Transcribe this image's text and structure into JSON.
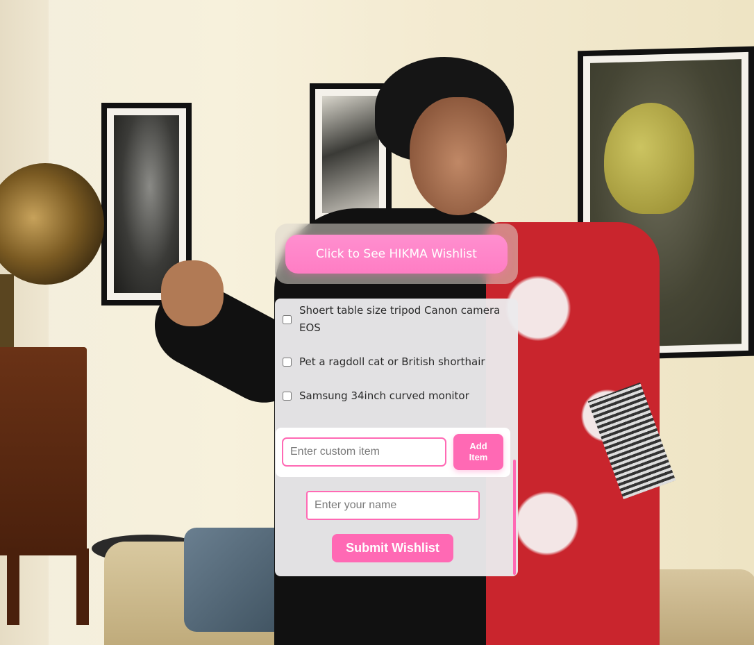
{
  "wishlist": {
    "toggle_label": "Click to See HIKMA Wishlist",
    "items": [
      {
        "label": "Shoert table size tripod Canon camera EOS",
        "checked": false
      },
      {
        "label": "Pet a ragdoll cat or British shorthair",
        "checked": false
      },
      {
        "label": "Samsung 34inch curved monitor",
        "checked": false
      }
    ],
    "custom_item": {
      "placeholder": "Enter custom item",
      "value": "",
      "add_label": "Add Item"
    },
    "name_field": {
      "placeholder": "Enter your name",
      "value": ""
    },
    "submit_label": "Submit Wishlist"
  },
  "colors": {
    "accent": "#ff69b4",
    "toggle_button": "#ff85c8",
    "panel": "#ebeaec"
  },
  "background": {
    "icon": "photo-background"
  }
}
